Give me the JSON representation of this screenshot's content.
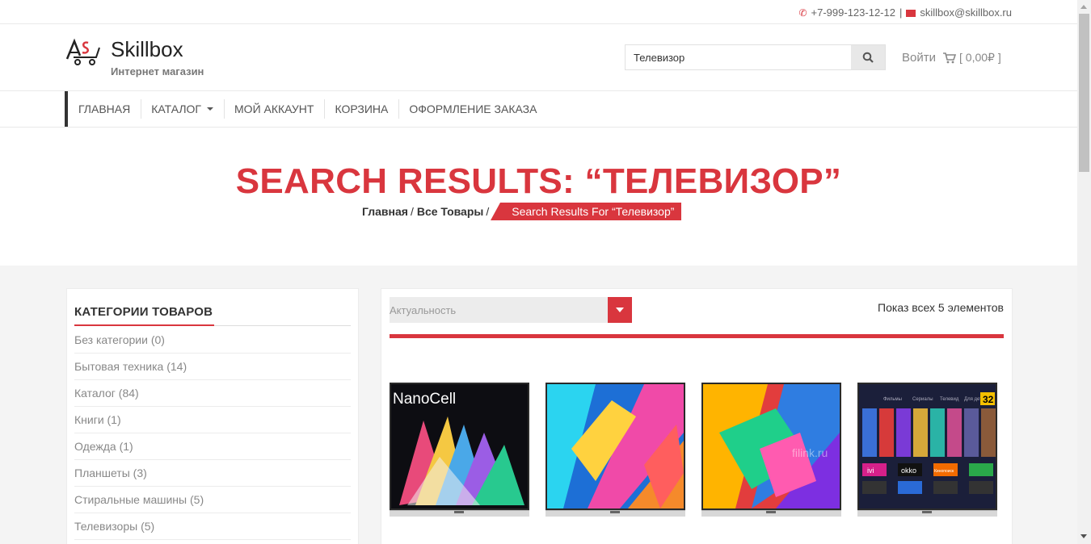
{
  "topbar": {
    "phone": "+7-999-123-12-12",
    "separator": "|",
    "email": "skillbox@skillbox.ru",
    "phone_icon": "phone-icon",
    "email_icon": "envelope-icon"
  },
  "header": {
    "brand": "Skillbox",
    "tagline": "Интернет магазин",
    "search_value": "Телевизор",
    "search_icon": "search-icon",
    "login": "Войти",
    "cart_icon": "cart-icon",
    "cart_total": "[ 0,00₽ ]"
  },
  "nav": {
    "items": [
      {
        "label": "ГЛАВНАЯ"
      },
      {
        "label": "КАТАЛОГ",
        "has_dropdown": true
      },
      {
        "label": "МОЙ АККАУНТ"
      },
      {
        "label": "КОРЗИНА"
      },
      {
        "label": "ОФОРМЛЕНИЕ ЗАКАЗА"
      }
    ]
  },
  "hero": {
    "title": "SEARCH RESULTS: “ТЕЛЕВИЗОР”",
    "breadcrumb": {
      "home": "Главная",
      "all": "Все Товары",
      "sep": "/",
      "current": "Search Results For “Телевизор”"
    }
  },
  "sidebar": {
    "title": "КАТЕГОРИИ ТОВАРОВ",
    "categories": [
      "Без категории (0)",
      "Бытовая техника (14)",
      "Каталог (84)",
      "Книги (1)",
      "Одежда (1)",
      "Планшеты (3)",
      "Стиральные машины (5)",
      "Телевизоры (5)"
    ]
  },
  "products": {
    "sort_label": "Актуальность",
    "count_text": "Показ всех 5 элементов",
    "tv1_text": "NanoCell",
    "tv3_watermark": "filink.ru",
    "tv4": {
      "tabs": [
        "Фильмы",
        "Сериалы",
        "Телевид",
        "Для детей"
      ],
      "badge": "32",
      "apps": [
        "ivi",
        "okko",
        "Кинопоиск"
      ]
    }
  },
  "colors": {
    "accent": "#d9363e",
    "text": "#333333",
    "muted": "#888888",
    "background_grey": "#f4f4f4"
  }
}
